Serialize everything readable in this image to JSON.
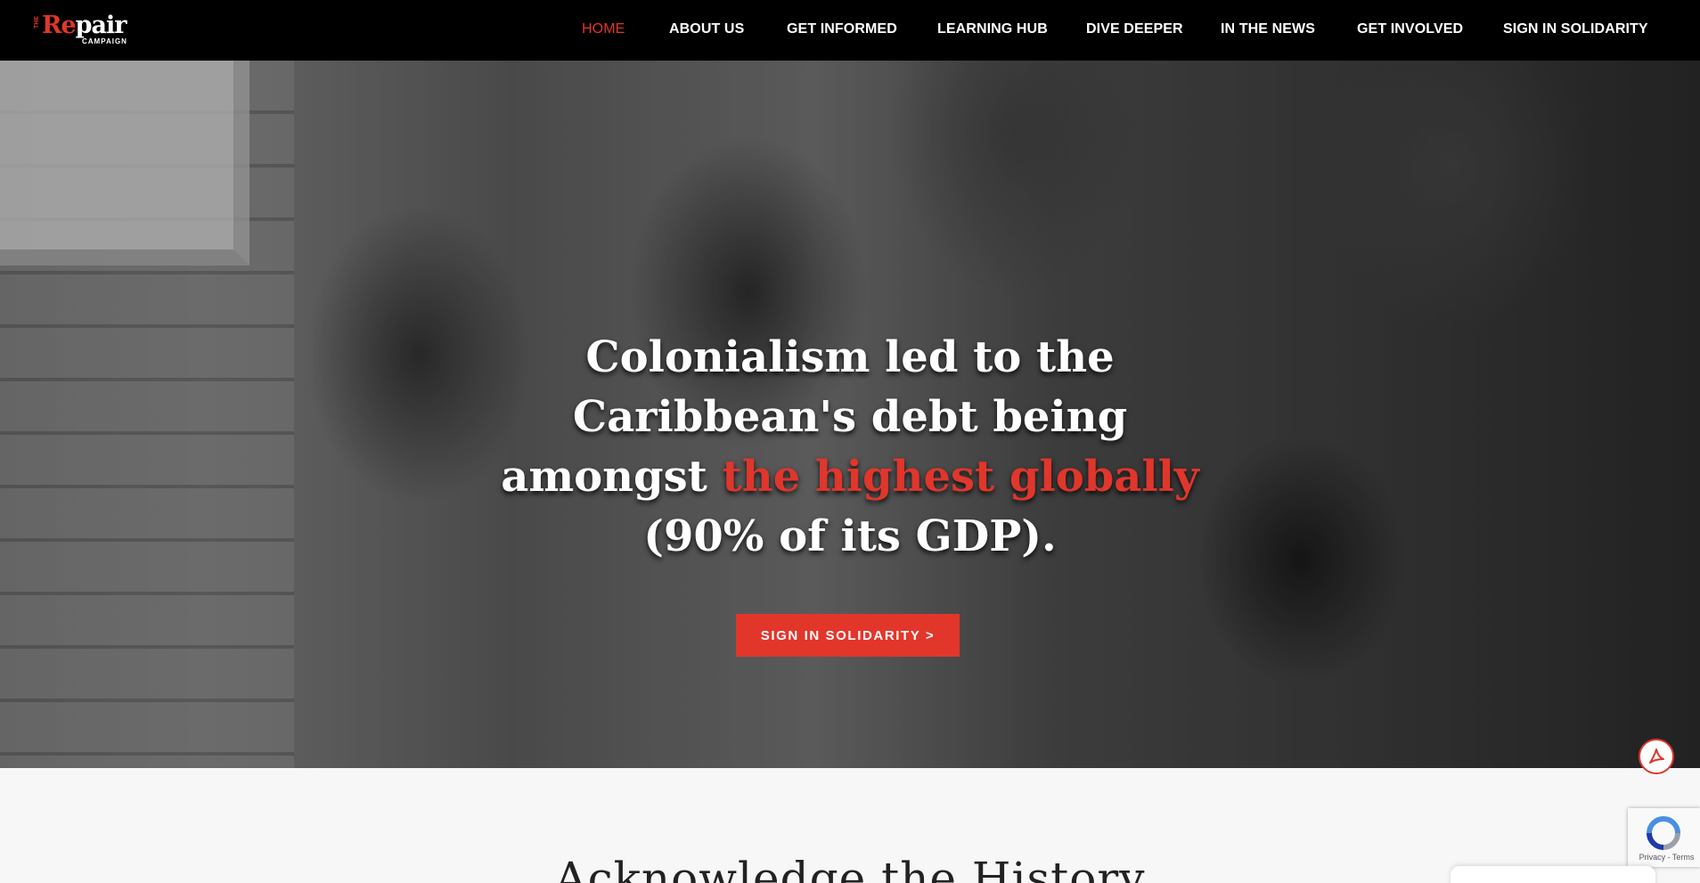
{
  "logo": {
    "the": "THE",
    "re": "Re",
    "pair": "pair",
    "campaign": "CAMPAIGN"
  },
  "nav": {
    "items": [
      {
        "label": "HOME",
        "active": true
      },
      {
        "label": "ABOUT US"
      },
      {
        "label": "GET INFORMED"
      },
      {
        "label": "LEARNING HUB"
      },
      {
        "label": "DIVE DEEPER"
      },
      {
        "label": "IN THE NEWS"
      },
      {
        "label": "GET INVOLVED"
      },
      {
        "label": "SIGN IN SOLIDARITY"
      }
    ]
  },
  "hero": {
    "headline_part1": "Colonialism led to the Caribbean's debt being amongst ",
    "headline_accent": "the highest globally",
    "headline_part2": " (90% of its GDP).",
    "cta_label": "SIGN IN SOLIDARITY >"
  },
  "section": {
    "title": "Acknowledge the History"
  },
  "recaptcha": {
    "terms": "Privacy - Terms"
  },
  "colors": {
    "accent": "#e0362c",
    "nav_bg": "#000000"
  },
  "icons": {
    "pdf": "pdf-icon",
    "recaptcha": "recaptcha-icon"
  }
}
